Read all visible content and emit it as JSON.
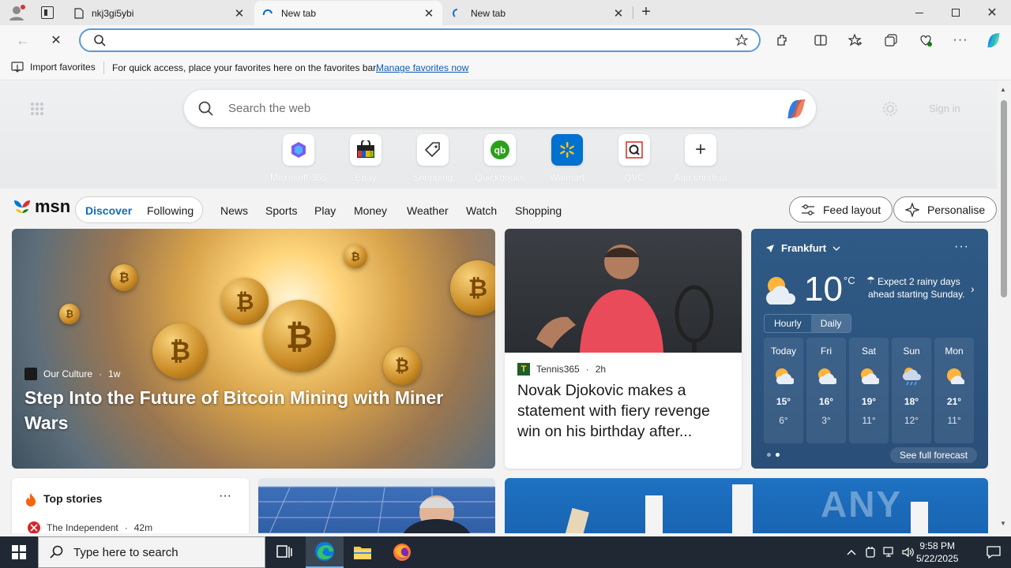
{
  "browser": {
    "tabs": [
      {
        "title": "nkj3gi5ybi"
      },
      {
        "title": "New tab"
      },
      {
        "title": "New tab"
      }
    ],
    "address_placeholder": ""
  },
  "favorites_bar": {
    "import_label": "Import favorites",
    "message": "For quick access, place your favorites here on the favorites bar.",
    "link": "Manage favorites now"
  },
  "newtab": {
    "search_placeholder": "Search the web",
    "signin": "Sign in",
    "shortcuts": [
      {
        "label": "Microsoft 365",
        "icon": "microsoft365-icon"
      },
      {
        "label": "Ebay",
        "icon": "ebay-icon"
      },
      {
        "label": "Shopping",
        "icon": "shopping-tag-icon"
      },
      {
        "label": "Quickbooks",
        "icon": "quickbooks-icon"
      },
      {
        "label": "Walmart",
        "icon": "walmart-icon"
      },
      {
        "label": "QVC",
        "icon": "qvc-icon"
      },
      {
        "label": "Add shortcut",
        "icon": "plus-icon"
      }
    ]
  },
  "msn_nav": {
    "brand": "msn",
    "discover": "Discover",
    "following": "Following",
    "links": [
      "News",
      "Sports",
      "Play",
      "Money",
      "Weather",
      "Watch",
      "Shopping"
    ],
    "feed_layout": "Feed layout",
    "personalise": "Personalise"
  },
  "hero": {
    "source": "Our Culture",
    "age": "1w",
    "headline": "Step Into the Future of Bitcoin Mining with Miner Wars"
  },
  "news2": {
    "source": "Tennis365",
    "age": "2h",
    "headline": "Novak Djokovic makes a statement with fiery revenge win on his birthday after..."
  },
  "weather": {
    "location": "Frankfurt",
    "temp": "10",
    "unit": "°C",
    "alert": "Expect 2 rainy days ahead starting Sunday.",
    "tab_hourly": "Hourly",
    "tab_daily": "Daily",
    "days": [
      {
        "name": "Today",
        "hi": "15°",
        "lo": "6°",
        "icon": "partly-sunny-icon"
      },
      {
        "name": "Fri",
        "hi": "16°",
        "lo": "3°",
        "icon": "partly-sunny-icon"
      },
      {
        "name": "Sat",
        "hi": "19°",
        "lo": "11°",
        "icon": "partly-sunny-icon"
      },
      {
        "name": "Sun",
        "hi": "18°",
        "lo": "12°",
        "icon": "rain-icon"
      },
      {
        "name": "Mon",
        "hi": "21°",
        "lo": "11°",
        "icon": "partly-sunny-icon"
      }
    ],
    "see_full": "See full forecast"
  },
  "top_stories": {
    "title": "Top stories",
    "source": "The Independent",
    "age": "42m"
  },
  "watermark": "ANY RUN",
  "taskbar": {
    "search_placeholder": "Type here to search",
    "time": "9:58 PM",
    "date": "5/22/2025"
  },
  "colors": {
    "accent": "#0f6cbd",
    "weather_bg": "#2f5a86",
    "taskbar": "#1f2833"
  }
}
